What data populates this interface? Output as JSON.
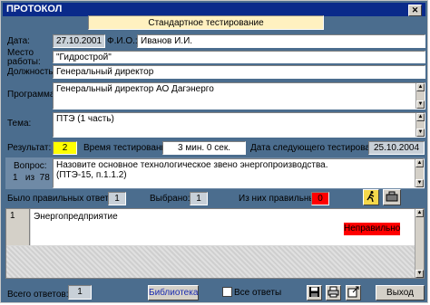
{
  "window": {
    "title": "ПРОТОКОЛ",
    "close_glyph": "✕"
  },
  "header": {
    "mode": "Стандартное тестирование"
  },
  "fields": {
    "date_label": "Дата:",
    "date_value": "27.10.2001",
    "fio_label": "Ф.И.О.:",
    "fio_value": "Иванов И.И.",
    "workplace_label": "Место работы:",
    "workplace_value": "\"Гидрострой\"",
    "position_label": "Должность:",
    "position_value": "Генеральный директор",
    "program_label": "Программа:",
    "program_value": "Генеральный директор АО Дагэнерго",
    "topic_label": "Тема:",
    "topic_value": "ПТЭ (1 часть)"
  },
  "results": {
    "result_label": "Результат:",
    "result_value": "2",
    "time_label": "Время тестирования:",
    "time_value": "3 мин. 0 сек.",
    "next_label": "Дата следующего тестирования:",
    "next_value": "25.10.2004"
  },
  "question": {
    "label": "Вопрос:",
    "number": "1",
    "of": "из",
    "total": "78",
    "text_line1": "Назовите основное   технологическое звено  энергопроизводства.",
    "text_line2": "(ПТЭ-15, п.1.1.2)"
  },
  "counters": {
    "correct_label": "Было правильных ответов:",
    "correct_value": "1",
    "selected_label": "Выбрано:",
    "selected_value": "1",
    "of_them_label": "Из них правильных:",
    "of_them_value": "0"
  },
  "answers": [
    {
      "num": "1",
      "text": "Энергопредприятие",
      "status": "Неправильно"
    }
  ],
  "footer": {
    "total_label": "Всего ответов:",
    "total_value": "1",
    "library": "Библиотека",
    "all_answers": "Все ответы",
    "exit": "Выход"
  },
  "icons": [
    "runner-icon",
    "tool-icon",
    "save-icon",
    "print-icon",
    "export-icon"
  ],
  "colors": {
    "title_bar": "#0a2a8a",
    "result_highlight": "#ffff00",
    "wrong": "#ff0000",
    "window_bg": "#4b6d8e"
  }
}
